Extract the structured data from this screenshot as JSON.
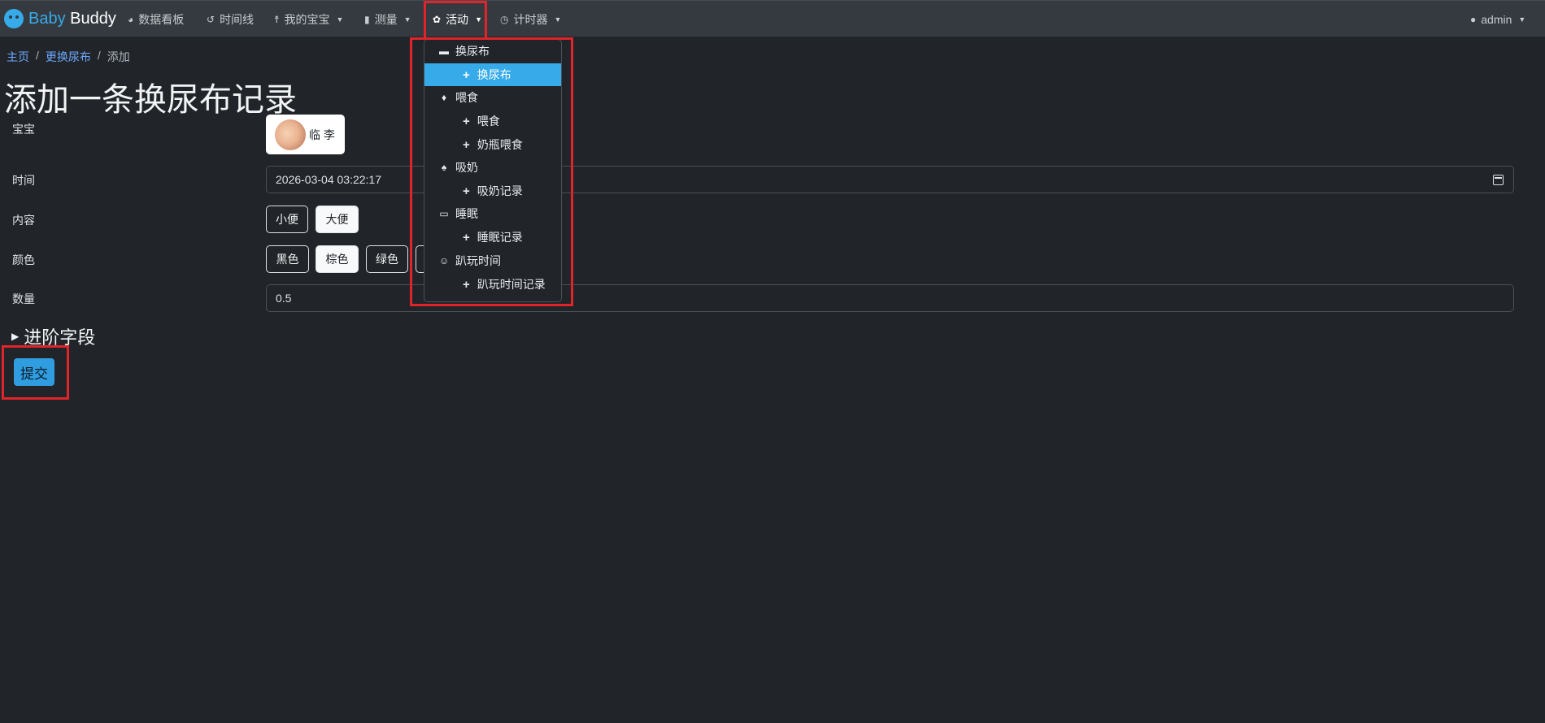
{
  "navbar": {
    "brand_part1": "Baby",
    "brand_part2": "Buddy",
    "items": [
      {
        "label": "数据看板",
        "icon": "dashboard-icon"
      },
      {
        "label": "时间线",
        "icon": "history-icon"
      },
      {
        "label": "我的宝宝",
        "icon": "child-icon"
      },
      {
        "label": "测量",
        "icon": "clipboard-icon"
      },
      {
        "label": "活动",
        "icon": "activities-icon"
      },
      {
        "label": "计时器",
        "icon": "timer-icon"
      }
    ],
    "user": "admin"
  },
  "breadcrumb": {
    "home": "主页",
    "section": "更换尿布",
    "current": "添加"
  },
  "page_title": "添加一条换尿布记录",
  "form": {
    "child_label": "宝宝",
    "child_name": "临 李",
    "time_label": "时间",
    "time_value": "2026-03-04 03:22:17",
    "contents_label": "内容",
    "contents_options": [
      "小便",
      "大便"
    ],
    "contents_selected": "大便",
    "color_label": "颜色",
    "color_options": [
      "黑色",
      "棕色",
      "绿色"
    ],
    "color_selected": "棕色",
    "amount_label": "数量",
    "amount_value": "0.5",
    "advanced_label": "进阶字段",
    "submit_label": "提交"
  },
  "dropdown": {
    "items": [
      {
        "type": "category",
        "label": "换尿布",
        "icon": "trash-icon"
      },
      {
        "type": "sub",
        "label": "换尿布",
        "highlighted": true
      },
      {
        "type": "category",
        "label": "喂食",
        "icon": "spoon-icon"
      },
      {
        "type": "sub",
        "label": "喂食"
      },
      {
        "type": "sub",
        "label": "奶瓶喂食"
      },
      {
        "type": "category",
        "label": "吸奶",
        "icon": "drop-icon"
      },
      {
        "type": "sub",
        "label": "吸奶记录"
      },
      {
        "type": "category",
        "label": "睡眠",
        "icon": "bed-icon"
      },
      {
        "type": "sub",
        "label": "睡眠记录"
      },
      {
        "type": "category",
        "label": "趴玩时间",
        "icon": "smile-icon"
      },
      {
        "type": "sub",
        "label": "趴玩时间记录"
      }
    ]
  },
  "colors": {
    "background": "#212529",
    "navbar": "#343a40",
    "accent": "#37abe9",
    "annotation": "#e0242a"
  }
}
